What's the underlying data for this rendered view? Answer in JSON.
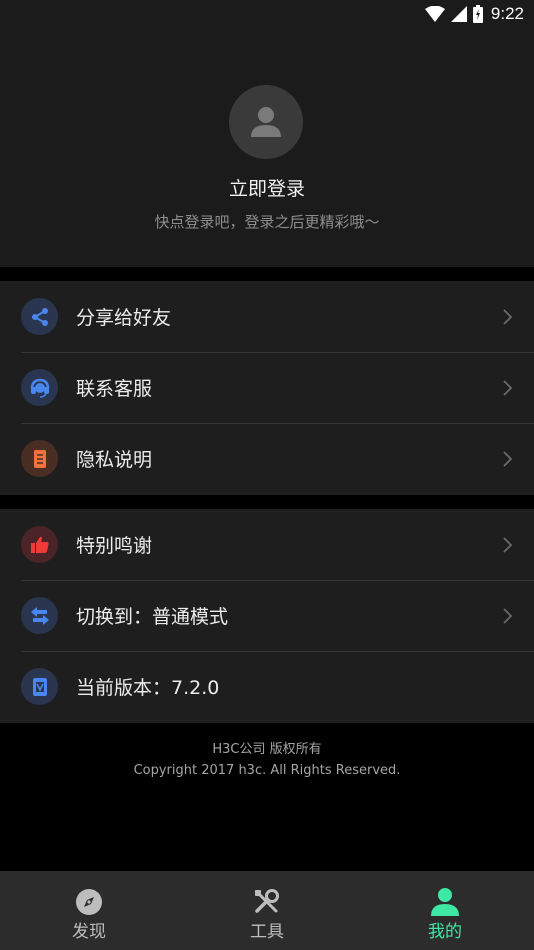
{
  "status_bar": {
    "time": "9:22"
  },
  "profile": {
    "login_title": "立即登录",
    "login_subtitle": "快点登录吧，登录之后更精彩哦～"
  },
  "menu_group1": [
    {
      "label": "分享给好友",
      "icon": "share-icon",
      "icon_bg": "#2a3550",
      "icon_color": "#4a86f0"
    },
    {
      "label": "联系客服",
      "icon": "headset-icon",
      "icon_bg": "#2a3550",
      "icon_color": "#4a86f0"
    },
    {
      "label": "隐私说明",
      "icon": "document-icon",
      "icon_bg": "#4a2e24",
      "icon_color": "#f0733f"
    }
  ],
  "menu_group2": [
    {
      "label": "特别鸣谢",
      "icon": "thumbs-up-icon",
      "icon_bg": "#4a2426",
      "icon_color": "#f03a3a"
    },
    {
      "label": "切换到：普通模式",
      "icon": "switch-arrows-icon",
      "icon_bg": "#2a3550",
      "icon_color": "#4a86f0"
    },
    {
      "label": "当前版本：7.2.0",
      "icon": "version-icon",
      "icon_bg": "#2a3550",
      "icon_color": "#4a86f0"
    }
  ],
  "footer": {
    "line1": "H3C公司 版权所有",
    "line2": "Copyright 2017 h3c. All Rights Reserved."
  },
  "tabs": [
    {
      "label": "发现",
      "icon": "compass-icon",
      "active": false
    },
    {
      "label": "工具",
      "icon": "tools-icon",
      "active": false
    },
    {
      "label": "我的",
      "icon": "person-icon",
      "active": true
    }
  ],
  "colors": {
    "accent": "#3ee8a4",
    "background": "#000000",
    "panel": "#1e1e1e"
  }
}
